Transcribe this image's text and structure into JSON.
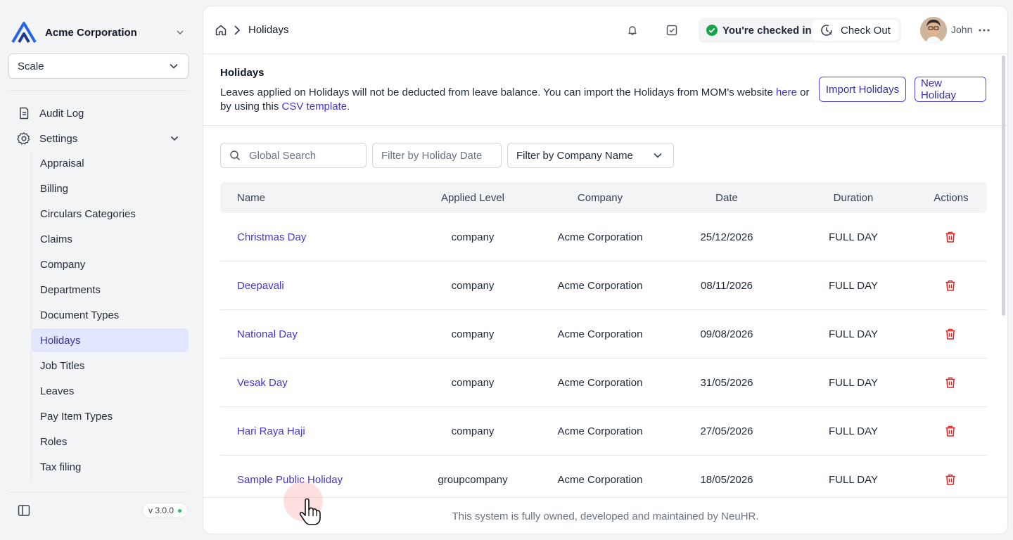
{
  "sidebar": {
    "org_name": "Acme Corporation",
    "scale_select": "Scale",
    "audit_log": "Audit Log",
    "settings": "Settings",
    "sub_items": [
      "Appraisal",
      "Billing",
      "Circulars Categories",
      "Claims",
      "Company",
      "Departments",
      "Document Types",
      "Holidays",
      "Job Titles",
      "Leaves",
      "Pay Item Types",
      "Roles",
      "Tax filing"
    ],
    "active_item": "Holidays",
    "version": "v 3.0.0"
  },
  "header": {
    "breadcrumb_current": "Holidays",
    "checkin_status": "You're checked in",
    "checkout_label": "Check Out",
    "user_name": "John"
  },
  "section": {
    "title": "Holidays",
    "desc_1": "Leaves applied on Holidays will not be deducted from leave balance. You can import the Holidays from MOM's website ",
    "link_here": "here",
    "desc_2": " or by using this ",
    "link_csv": "CSV template.",
    "import_label": "Import Holidays",
    "new_label": "New Holiday"
  },
  "filters": {
    "search_placeholder": "Global Search",
    "date_placeholder": "Filter by Holiday Date",
    "company_label": "Filter by Company Name"
  },
  "table": {
    "columns": [
      "Name",
      "Applied Level",
      "Company",
      "Date",
      "Duration",
      "Actions"
    ],
    "rows": [
      {
        "name": "Christmas Day",
        "level": "company",
        "company": "Acme Corporation",
        "date": "25/12/2026",
        "duration": "FULL DAY"
      },
      {
        "name": "Deepavali",
        "level": "company",
        "company": "Acme Corporation",
        "date": "08/11/2026",
        "duration": "FULL DAY"
      },
      {
        "name": "National Day",
        "level": "company",
        "company": "Acme Corporation",
        "date": "09/08/2026",
        "duration": "FULL DAY"
      },
      {
        "name": "Vesak Day",
        "level": "company",
        "company": "Acme Corporation",
        "date": "31/05/2026",
        "duration": "FULL DAY"
      },
      {
        "name": "Hari Raya Haji",
        "level": "company",
        "company": "Acme Corporation",
        "date": "27/05/2026",
        "duration": "FULL DAY"
      },
      {
        "name": "Sample Public Holiday",
        "level": "groupcompany",
        "company": "Acme Corporation",
        "date": "18/05/2026",
        "duration": "FULL DAY"
      }
    ]
  },
  "footer": {
    "text": "This system is fully owned, developed and maintained by NeuHR."
  },
  "colors": {
    "accent": "#4338ca",
    "active_bg": "#e0e7ff",
    "danger": "#dc2626",
    "success": "#16a34a"
  },
  "icons": [
    "logo-icon",
    "chevron-down-icon",
    "audit-log-icon",
    "gear-icon",
    "home-icon",
    "chevron-right-icon",
    "bell-icon",
    "checkbox-icon",
    "check-circle-icon",
    "clock-icon",
    "more-icon",
    "search-icon",
    "trash-icon",
    "sidebar-toggle-icon",
    "pointer-cursor-icon"
  ]
}
